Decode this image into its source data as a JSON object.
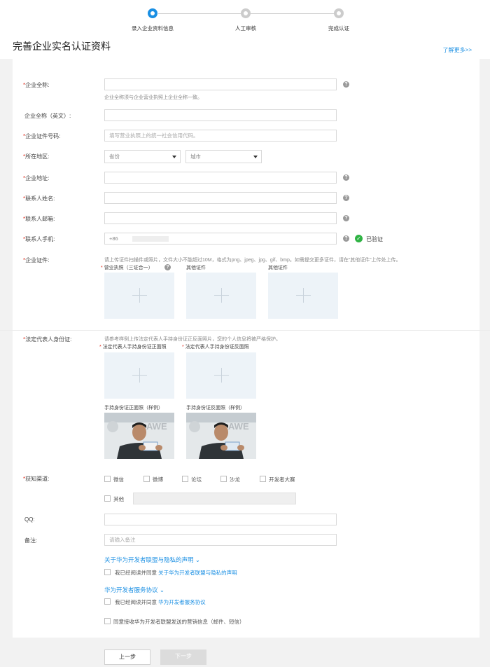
{
  "steps": [
    {
      "label": "录入企业资料信息",
      "active": true
    },
    {
      "label": "人工审核",
      "active": false
    },
    {
      "label": "完成认证",
      "active": false
    }
  ],
  "page_title": "完善企业实名认证资料",
  "learn_more": "了解更多>>",
  "form": {
    "company_name_label": "企业全称:",
    "company_name_hint": "企业全称须与企业营业执照上企业全称一致。",
    "company_name_en_label": "企业全称（英文）:",
    "cert_no_label": "企业证件号码:",
    "cert_no_placeholder": "填写营业执照上的统一社会信用代码。",
    "region_label": "所在地区:",
    "province_placeholder": "省份",
    "city_placeholder": "城市",
    "address_label": "企业地址:",
    "contact_name_label": "联系人姓名:",
    "contact_email_label": "联系人邮箱:",
    "contact_phone_label": "联系人手机:",
    "phone_prefix": "+86",
    "verified_text": "已验证",
    "docs_label": "企业证件:",
    "docs_hint": "请上传证件扫描件或照片，文件大小不能超过10M，格式为png、jpeg、jpg、gif、bmp。如需提交更多证件，请在“其他证件”上传处上传。",
    "doc_license": "营业执照（三证合一）",
    "doc_other1": "其他证件",
    "doc_other2": "其他证件",
    "legal_label": "法定代表人身份证:",
    "legal_hint": "请参考样例上传法定代表人手持身份证正反面照片，您的个人信息将被严格保护。",
    "legal_front": "法定代表人手持身份证正面照",
    "legal_back": "法定代表人手持身份证反面照",
    "sample_front": "手持身份证正面照（样例）",
    "sample_back": "手持身份证反面照（样例）",
    "channel_label": "获知渠道:",
    "channels": [
      "微信",
      "微博",
      "论坛",
      "沙龙",
      "开发者大赛"
    ],
    "channel_other": "其他",
    "qq_label": "QQ:",
    "remark_label": "备注:",
    "remark_placeholder": "请输入备注",
    "privacy_section": "关于华为开发者联盟与隐私的声明",
    "privacy_agree_prefix": "我已经阅读并同意",
    "privacy_agree_link": "关于华为开发者联盟与隐私的声明",
    "service_section": "华为开发者服务协议",
    "service_agree_prefix": "我已经阅读并同意",
    "service_agree_link": "华为开发者服务协议",
    "marketing_consent": "同意接收华为开发者联盟发送的营销信息（邮件、短信）"
  },
  "buttons": {
    "prev": "上一步",
    "next": "下一步"
  },
  "colors": {
    "accent": "#1a8fe3",
    "required": "#e0301e",
    "verified": "#2fb344"
  }
}
